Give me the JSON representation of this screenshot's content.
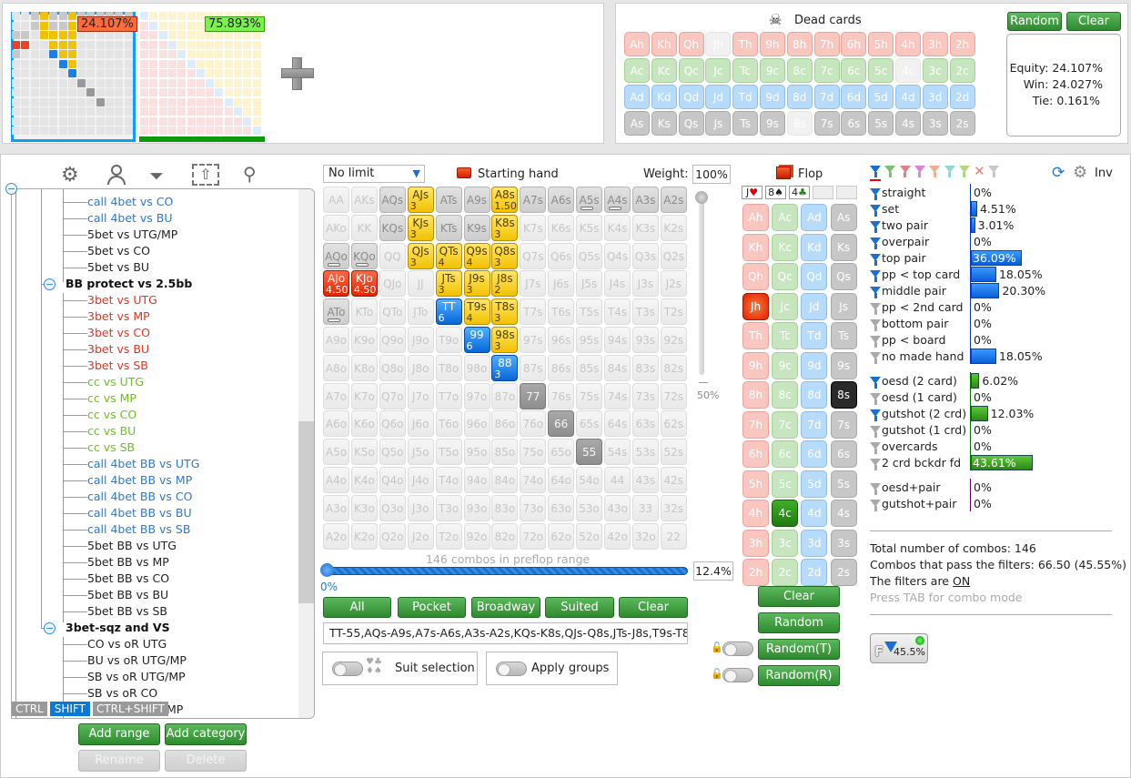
{
  "thumbnails": [
    {
      "percent": "24.107%",
      "selected": true
    },
    {
      "percent": "75.893%",
      "selected": false
    }
  ],
  "dead_cards": {
    "title": "Dead cards",
    "random_label": "Random",
    "clear_label": "Clear",
    "rows": [
      [
        "Ah",
        "Kh",
        "Qh",
        "Jh",
        "Th",
        "9h",
        "8h",
        "7h",
        "6h",
        "5h",
        "4h",
        "3h",
        "2h"
      ],
      [
        "Ac",
        "Kc",
        "Qc",
        "Jc",
        "Tc",
        "9c",
        "8c",
        "7c",
        "6c",
        "5c",
        "4c",
        "3c",
        "2c"
      ],
      [
        "Ad",
        "Kd",
        "Qd",
        "Jd",
        "Td",
        "9d",
        "8d",
        "7d",
        "6d",
        "5d",
        "4d",
        "3d",
        "2d"
      ],
      [
        "As",
        "Ks",
        "Qs",
        "Js",
        "Ts",
        "9s",
        "8s",
        "7s",
        "6s",
        "5s",
        "4s",
        "3s",
        "2s"
      ]
    ],
    "unavailable": [
      "Jh",
      "4c",
      "8s"
    ]
  },
  "equity": {
    "equity": "Equity: 24.107%",
    "win": "Win: 24.027%",
    "tie": "Tie: 0.161%"
  },
  "toolbar_icons": [
    "gear-icon",
    "user-icon",
    "filter-icon",
    "export-icon",
    "search-icon"
  ],
  "tree": [
    {
      "label": "call 4bet vs CO",
      "level": 2,
      "color": "#2a7ad2"
    },
    {
      "label": "call 4bet vs BU",
      "level": 2,
      "color": "#2a7ad2"
    },
    {
      "label": "5bet vs UTG/MP",
      "level": 2,
      "color": "#222222"
    },
    {
      "label": "5bet vs CO",
      "level": 2,
      "color": "#222222"
    },
    {
      "label": "5bet vs BU",
      "level": 2,
      "color": "#222222"
    },
    {
      "label": "BB protect vs 2.5bb",
      "level": 1,
      "color": "#111111"
    },
    {
      "label": "3bet vs UTG",
      "level": 2,
      "color": "#e5331f"
    },
    {
      "label": "3bet vs MP",
      "level": 2,
      "color": "#e5331f"
    },
    {
      "label": "3bet vs CO",
      "level": 2,
      "color": "#e5331f"
    },
    {
      "label": "3bet vs BU",
      "level": 2,
      "color": "#e5331f"
    },
    {
      "label": "3bet vs SB",
      "level": 2,
      "color": "#e5331f"
    },
    {
      "label": "cc vs UTG",
      "level": 2,
      "color": "#6fbf1f"
    },
    {
      "label": "cc vs MP",
      "level": 2,
      "color": "#6fbf1f"
    },
    {
      "label": "cc vs CO",
      "level": 2,
      "color": "#6fbf1f"
    },
    {
      "label": "cc vs BU",
      "level": 2,
      "color": "#6fbf1f"
    },
    {
      "label": "cc vs SB",
      "level": 2,
      "color": "#6fbf1f"
    },
    {
      "label": "call 4bet BB vs UTG",
      "level": 2,
      "color": "#2a7ad2"
    },
    {
      "label": "call 4bet BB vs MP",
      "level": 2,
      "color": "#2a7ad2"
    },
    {
      "label": "call 4bet BB vs CO",
      "level": 2,
      "color": "#2a7ad2"
    },
    {
      "label": "call 4bet BB vs BU",
      "level": 2,
      "color": "#2a7ad2"
    },
    {
      "label": "call 4bet BB vs SB",
      "level": 2,
      "color": "#2a7ad2"
    },
    {
      "label": "5bet BB vs UTG",
      "level": 2,
      "color": "#222222"
    },
    {
      "label": "5bet BB vs MP",
      "level": 2,
      "color": "#222222"
    },
    {
      "label": "5bet BB vs CO",
      "level": 2,
      "color": "#222222"
    },
    {
      "label": "5bet BB vs BU",
      "level": 2,
      "color": "#222222"
    },
    {
      "label": "5bet BB vs SB",
      "level": 2,
      "color": "#222222"
    },
    {
      "label": "3bet-sqz and VS",
      "level": 1,
      "color": "#111111"
    },
    {
      "label": "CO vs oR UTG",
      "level": 2,
      "color": "#222222"
    },
    {
      "label": "BU vs oR UTG/MP",
      "level": 2,
      "color": "#222222"
    },
    {
      "label": "SB vs oR UTG/MP",
      "level": 2,
      "color": "#222222"
    },
    {
      "label": "SB vs oR CO",
      "level": 2,
      "color": "#222222"
    }
  ],
  "tree_partial": "MP",
  "modifier_keys": {
    "ctrl": "CTRL",
    "shift": "SHIFT",
    "ctrl_shift": "CTRL+SHIFT"
  },
  "tree_buttons": {
    "add_range": "Add range",
    "add_category": "Add category",
    "rename": "Rename",
    "delete": "Delete"
  },
  "range": {
    "game_type": "No limit",
    "starting_hand_label": "Starting hand",
    "weight_label": "Weight:",
    "weight_value": "100%",
    "weight_slider_label": "50%",
    "hands": [
      [
        "AA",
        "AKs",
        "AQs",
        "AJs",
        "ATs",
        "A9s",
        "A8s",
        "A7s",
        "A6s",
        "A5s",
        "A4s",
        "A3s",
        "A2s"
      ],
      [
        "AKo",
        "KK",
        "KQs",
        "KJs",
        "KTs",
        "K9s",
        "K8s",
        "K7s",
        "K6s",
        "K5s",
        "K4s",
        "K3s",
        "K2s"
      ],
      [
        "AQo",
        "KQo",
        "QQ",
        "QJs",
        "QTs",
        "Q9s",
        "Q8s",
        "Q7s",
        "Q6s",
        "Q5s",
        "Q4s",
        "Q3s",
        "Q2s"
      ],
      [
        "AJo",
        "KJo",
        "QJo",
        "JJ",
        "JTs",
        "J9s",
        "J8s",
        "J7s",
        "J6s",
        "J5s",
        "J4s",
        "J3s",
        "J2s"
      ],
      [
        "ATo",
        "KTo",
        "QTo",
        "JTo",
        "TT",
        "T9s",
        "T8s",
        "T7s",
        "T6s",
        "T5s",
        "T4s",
        "T3s",
        "T2s"
      ],
      [
        "A9o",
        "K9o",
        "Q9o",
        "J9o",
        "T9o",
        "99",
        "98s",
        "97s",
        "96s",
        "95s",
        "94s",
        "93s",
        "92s"
      ],
      [
        "A8o",
        "K8o",
        "Q8o",
        "J8o",
        "T8o",
        "98o",
        "88",
        "87s",
        "86s",
        "85s",
        "84s",
        "83s",
        "82s"
      ],
      [
        "A7o",
        "K7o",
        "Q7o",
        "J7o",
        "T7o",
        "97o",
        "87o",
        "77",
        "76s",
        "75s",
        "74s",
        "73s",
        "72s"
      ],
      [
        "A6o",
        "K6o",
        "Q6o",
        "J6o",
        "T6o",
        "96o",
        "86o",
        "76o",
        "66",
        "65s",
        "64s",
        "63s",
        "62s"
      ],
      [
        "A5o",
        "K5o",
        "Q5o",
        "J5o",
        "T5o",
        "95o",
        "85o",
        "75o",
        "65o",
        "55",
        "54s",
        "53s",
        "52s"
      ],
      [
        "A4o",
        "K4o",
        "Q4o",
        "J4o",
        "T4o",
        "94o",
        "84o",
        "74o",
        "64o",
        "54o",
        "44",
        "43s",
        "42s"
      ],
      [
        "A3o",
        "K3o",
        "Q3o",
        "J3o",
        "T3o",
        "93o",
        "83o",
        "73o",
        "63o",
        "53o",
        "43o",
        "33",
        "32s"
      ],
      [
        "A2o",
        "K2o",
        "Q2o",
        "J2o",
        "T2o",
        "92o",
        "82o",
        "72o",
        "62o",
        "52o",
        "42o",
        "32o",
        "22"
      ]
    ],
    "highlights": {
      "AQs": {
        "state": "filtered"
      },
      "ATs": {
        "state": "filtered"
      },
      "A9s": {
        "state": "filtered"
      },
      "A7s": {
        "state": "filtered"
      },
      "A6s": {
        "state": "filtered"
      },
      "A5s": {
        "state": "filtered",
        "partial": true
      },
      "A4s": {
        "state": "filtered",
        "partial": true
      },
      "A3s": {
        "state": "filtered"
      },
      "A2s": {
        "state": "filtered"
      },
      "KQs": {
        "state": "filtered"
      },
      "KTs": {
        "state": "filtered"
      },
      "K9s": {
        "state": "filtered"
      },
      "AQo": {
        "state": "filtered",
        "partial": true
      },
      "KQo": {
        "state": "filtered",
        "partial": true
      },
      "ATo": {
        "state": "filtered",
        "partial": true
      },
      "77": {
        "state": "filtered-pair"
      },
      "66": {
        "state": "filtered-pair"
      },
      "55": {
        "state": "filtered-pair"
      },
      "AJs": {
        "state": "draw",
        "combos": "3"
      },
      "A8s": {
        "state": "draw",
        "combos": "1.50"
      },
      "KJs": {
        "state": "draw",
        "combos": "3"
      },
      "K8s": {
        "state": "draw",
        "combos": "3"
      },
      "QJs": {
        "state": "draw",
        "combos": "3"
      },
      "QTs": {
        "state": "draw",
        "combos": "4"
      },
      "Q9s": {
        "state": "draw",
        "combos": "4"
      },
      "Q8s": {
        "state": "draw",
        "combos": "3"
      },
      "JTs": {
        "state": "draw",
        "combos": "3"
      },
      "J9s": {
        "state": "draw",
        "combos": "3"
      },
      "J8s": {
        "state": "draw",
        "combos": "2"
      },
      "T9s": {
        "state": "draw",
        "combos": "4"
      },
      "T8s": {
        "state": "draw",
        "combos": "3"
      },
      "98s": {
        "state": "draw",
        "combos": "3"
      },
      "AJo": {
        "state": "toppair",
        "combos": "4.50"
      },
      "KJo": {
        "state": "toppair",
        "combos": "4.50"
      },
      "TT": {
        "state": "pair",
        "combos": "6"
      },
      "99": {
        "state": "pair",
        "combos": "6"
      },
      "88": {
        "state": "pair",
        "combos": "3"
      }
    },
    "combos_text": "146 combos in preflop range",
    "slider_value": "0%",
    "percent_value": "12.4%",
    "slider_fraction": 0.0,
    "buttons": {
      "all": "All",
      "pocket": "Pocket",
      "broadway": "Broadway",
      "suited": "Suited",
      "clear": "Clear"
    },
    "range_text": "TT-55,AQs-A9s,A7s-A6s,A3s-A2s,KQs-K8s,QJs-Q8s,JTs-J8s,T9s-T8s,",
    "suit_selection": "Suit selection",
    "apply_groups": "Apply groups"
  },
  "flop": {
    "title": "Flop",
    "board": [
      {
        "rank": "J",
        "suit": "♥",
        "color": "#e00000"
      },
      {
        "rank": "8",
        "suit": "♠",
        "color": "#222222"
      },
      {
        "rank": "4",
        "suit": "♣",
        "color": "#1c8a10"
      }
    ],
    "ranks": [
      "A",
      "K",
      "Q",
      "J",
      "T",
      "9",
      "8",
      "7",
      "6",
      "5",
      "4",
      "3",
      "2"
    ],
    "suits": [
      "h",
      "c",
      "d",
      "s"
    ],
    "selected": {
      "Jh": "selR",
      "4c": "selG",
      "8s": "selK"
    },
    "buttons": {
      "clear": "Clear",
      "random": "Random",
      "random_t": "Random(T)",
      "random_r": "Random(R)"
    }
  },
  "filters": {
    "colors": [
      "#1a6fd0",
      "#7fc070",
      "#e08080",
      "#e080e0",
      "#f0b090",
      "#90d8d8",
      "#b0d880",
      "x",
      "#c8c8c8"
    ],
    "inv_label": "Inv",
    "made": [
      {
        "label": "straight",
        "value": "0%",
        "pct": 0,
        "active": true
      },
      {
        "label": "set",
        "value": "4.51%",
        "pct": 4.51,
        "active": true
      },
      {
        "label": "two pair",
        "value": "3.01%",
        "pct": 3.01,
        "active": true
      },
      {
        "label": "overpair",
        "value": "0%",
        "pct": 0,
        "active": true
      },
      {
        "label": "top pair",
        "value": "36.09%",
        "pct": 36.09,
        "active": true,
        "inside": true
      },
      {
        "label": "pp < top card",
        "value": "18.05%",
        "pct": 18.05,
        "active": true
      },
      {
        "label": "middle pair",
        "value": "20.30%",
        "pct": 20.3,
        "active": true
      },
      {
        "label": "pp < 2nd card",
        "value": "0%",
        "pct": 0,
        "active": false
      },
      {
        "label": "bottom pair",
        "value": "0%",
        "pct": 0,
        "active": false
      },
      {
        "label": "pp < board",
        "value": "0%",
        "pct": 0,
        "active": false
      },
      {
        "label": "no made hand",
        "value": "18.05%",
        "pct": 18.05,
        "active": false
      }
    ],
    "draws": [
      {
        "label": "oesd (2 card)",
        "value": "6.02%",
        "pct": 6.02,
        "active": true
      },
      {
        "label": "oesd (1 card)",
        "value": "0%",
        "pct": 0,
        "active": false
      },
      {
        "label": "gutshot (2 crd)",
        "value": "12.03%",
        "pct": 12.03,
        "active": true
      },
      {
        "label": "gutshot (1 crd)",
        "value": "0%",
        "pct": 0,
        "active": false
      },
      {
        "label": "overcards",
        "value": "0%",
        "pct": 0,
        "active": false
      },
      {
        "label": "2 crd bckdr fd",
        "value": "43.61%",
        "pct": 43.61,
        "active": false,
        "inside": true
      }
    ],
    "combo": [
      {
        "label": "oesd+pair",
        "value": "0%",
        "pct": 0,
        "active": false
      },
      {
        "label": "gutshot+pair",
        "value": "0%",
        "pct": 0,
        "active": false
      }
    ]
  },
  "summary": {
    "total": "Total number of combos: 146",
    "pass": "Combos that pass the filters: 66.50 (45.55%)",
    "filters_prefix": "The filters are ",
    "filters_state": "ON",
    "hint": "Press TAB for combo mode",
    "badge_letter": "F",
    "badge_value": "45.5%"
  }
}
